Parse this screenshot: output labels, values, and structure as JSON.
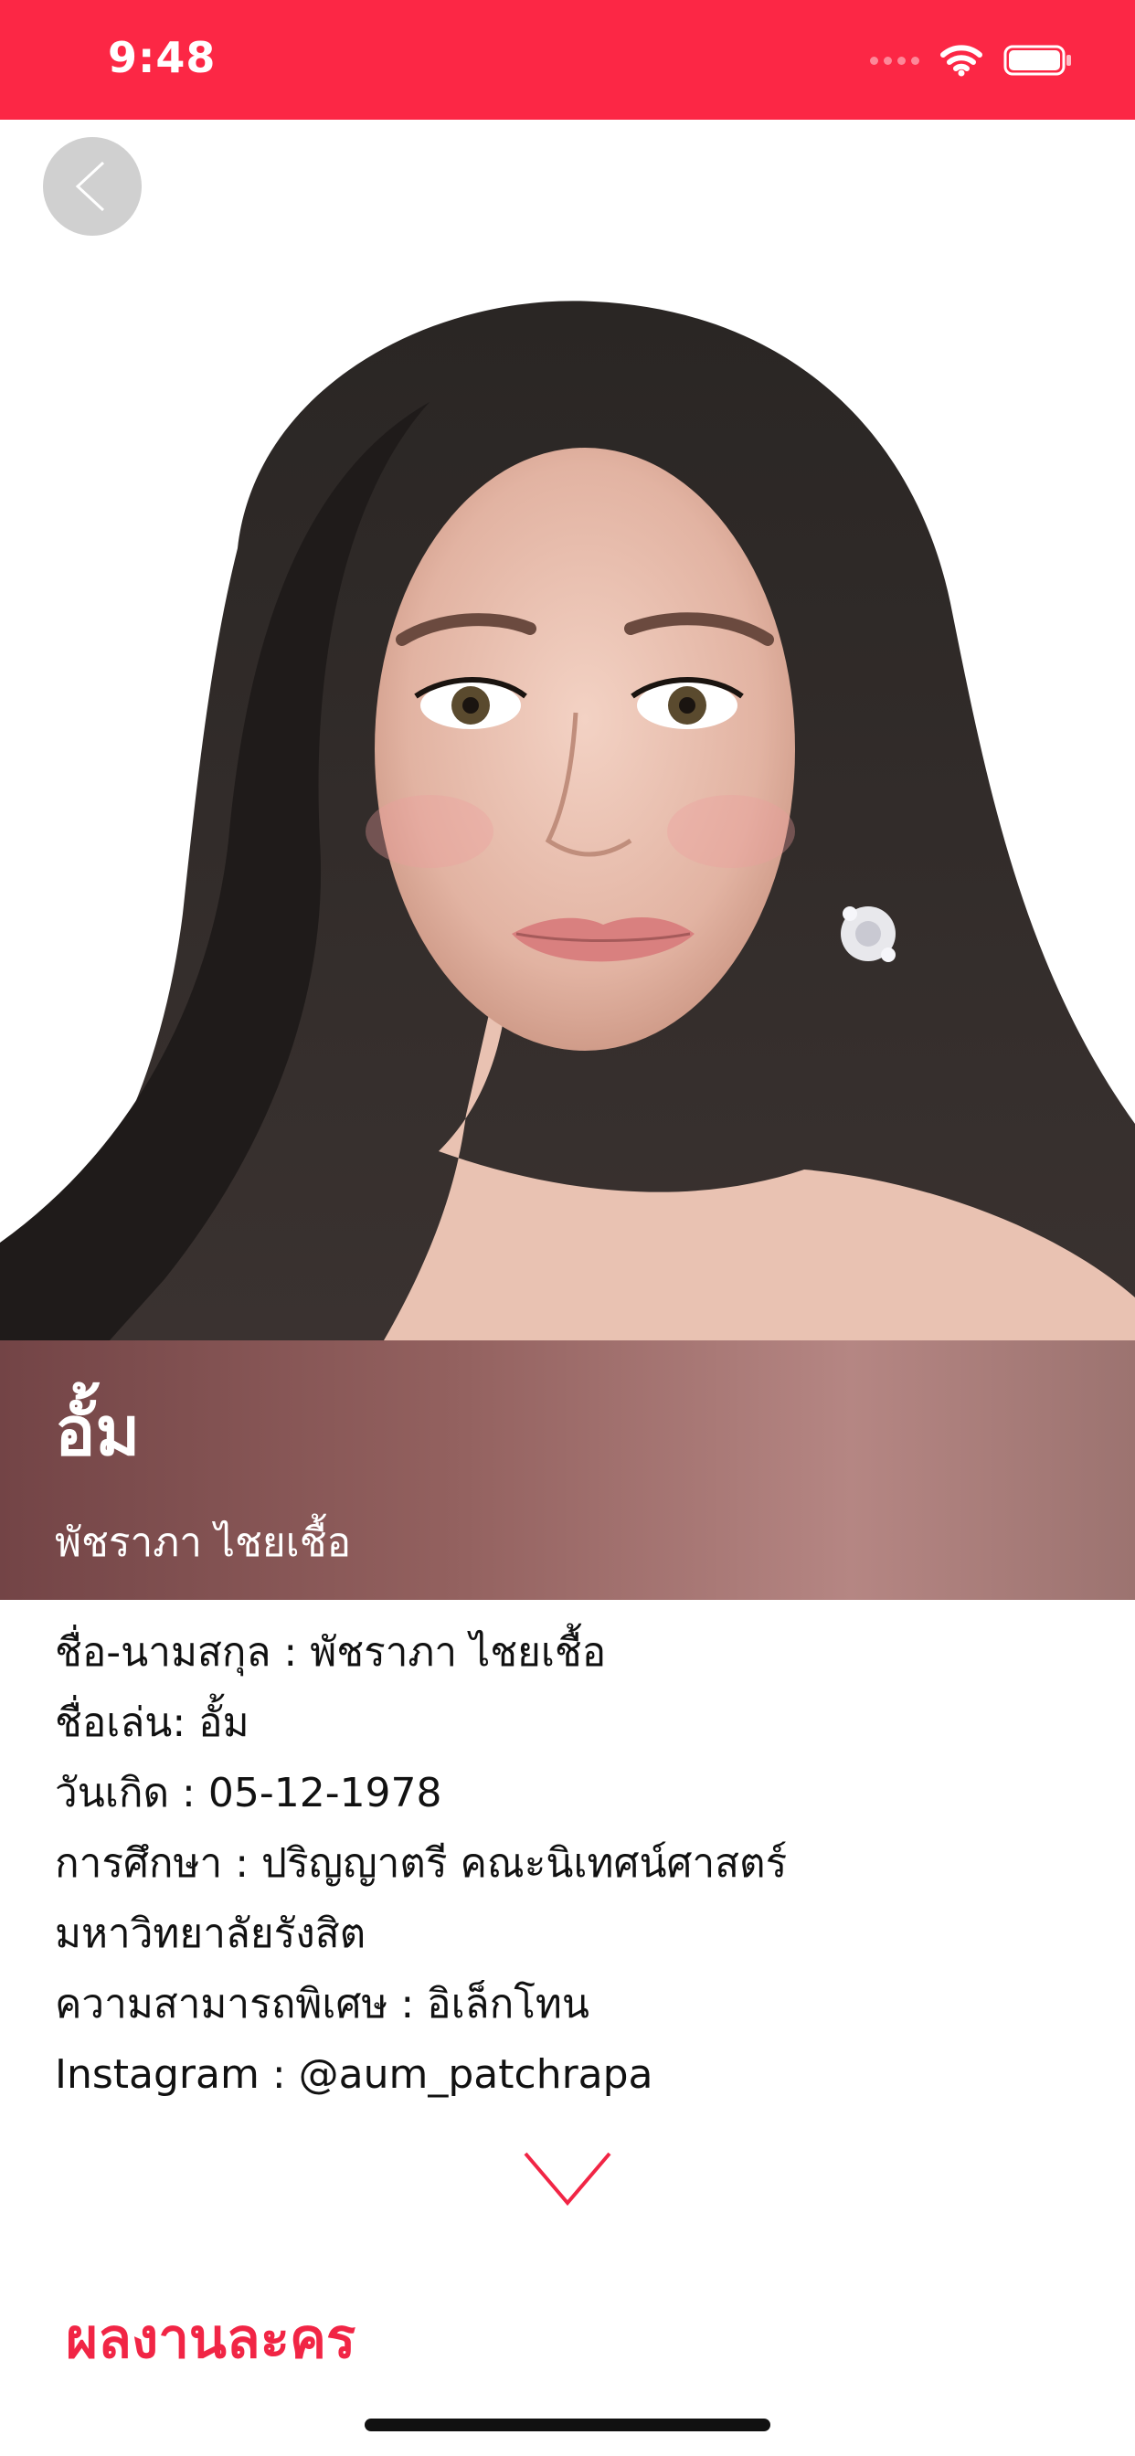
{
  "status_bar": {
    "time": "9:48",
    "background_color": "#fc2745",
    "icons": [
      "cellular-signal-icon",
      "wifi-icon",
      "battery-icon"
    ]
  },
  "navigation": {
    "back_icon": "chevron-left-icon"
  },
  "profile": {
    "photo_icon": "portrait-photo",
    "nickname_title": "อั้ม",
    "full_name_subtitle": "พัชราภา ไชยเชื้อ",
    "banner_color": "#93615f"
  },
  "info": {
    "lines": [
      "ชื่อ-นามสกุล : พัชราภา ไชยเชื้อ",
      "ชื่อเล่น: อั้ม",
      "วันเกิด : 05-12-1978",
      "การศึกษา : ปริญญาตรี คณะนิเทศน์ศาสตร์",
      "มหาวิทยาลัยรังสิต",
      "ความสามารถพิเศษ : อิเล็กโทน",
      "Instagram : @aum_patchrapa"
    ],
    "expand_icon": "chevron-down-icon"
  },
  "works_section": {
    "heading": "ผลงานละคร",
    "accent_color": "#f12545"
  }
}
